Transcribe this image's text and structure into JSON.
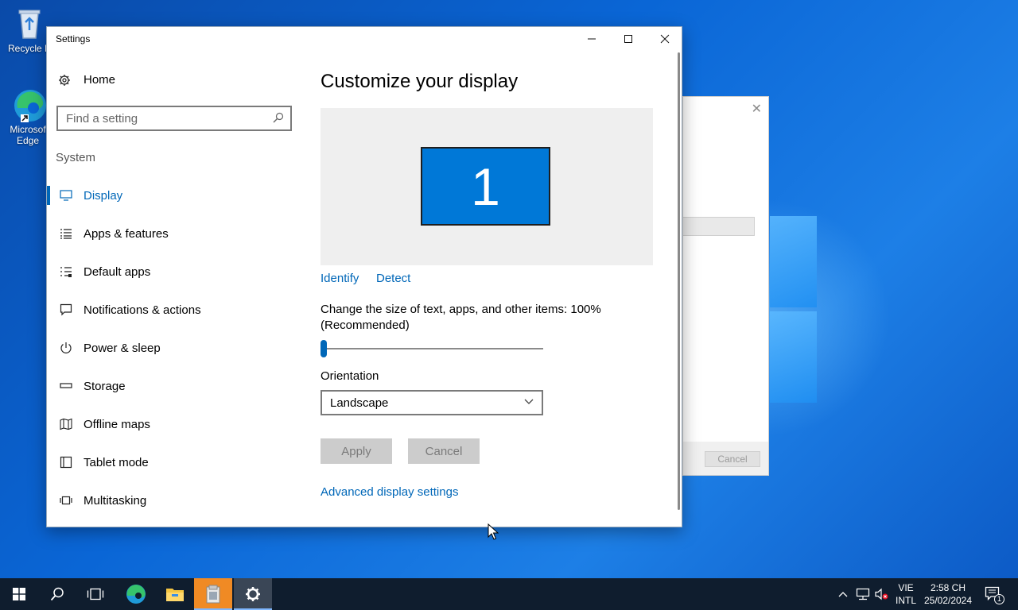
{
  "desktop": {
    "icons": [
      {
        "label": "Recycle Bin",
        "display": "Recycle B",
        "icon": "recycle-bin-icon"
      },
      {
        "label_line1": "Microsoft",
        "label_line2": "Edge",
        "display1": "Microsof",
        "icon": "edge-icon"
      }
    ]
  },
  "window": {
    "title": "Settings",
    "controls": {
      "minimize": "minimize-icon",
      "maximize": "maximize-icon",
      "close": "close-icon"
    }
  },
  "sidebar": {
    "home_label": "Home",
    "search_placeholder": "Find a setting",
    "section_label": "System",
    "items": [
      {
        "label": "Display",
        "icon": "monitor-icon",
        "active": true
      },
      {
        "label": "Apps & features",
        "icon": "list-icon"
      },
      {
        "label": "Default apps",
        "icon": "default-apps-icon"
      },
      {
        "label": "Notifications & actions",
        "icon": "notification-icon"
      },
      {
        "label": "Power & sleep",
        "icon": "power-icon"
      },
      {
        "label": "Storage",
        "icon": "storage-icon"
      },
      {
        "label": "Offline maps",
        "icon": "map-icon"
      },
      {
        "label": "Tablet mode",
        "icon": "tablet-icon"
      },
      {
        "label": "Multitasking",
        "icon": "multitasking-icon"
      }
    ]
  },
  "main": {
    "heading": "Customize your display",
    "monitor_number": "1",
    "identify_link": "Identify",
    "detect_link": "Detect",
    "scale_label_line1": "Change the size of text, apps, and other items: 100%",
    "scale_label_line2": "(Recommended)",
    "scale_slider_value": 0,
    "orientation_label": "Orientation",
    "orientation_value": "Landscape",
    "apply_label": "Apply",
    "cancel_label": "Cancel",
    "advanced_link": "Advanced display settings"
  },
  "background_dialog": {
    "cancel_label": "Cancel"
  },
  "taskbar": {
    "items": [
      "start-icon",
      "search-icon",
      "task-view-icon",
      "edge-icon",
      "file-explorer-icon",
      "installer-icon",
      "settings-icon"
    ],
    "language_line1": "VIE",
    "language_line2": "INTL",
    "time": "2:58 CH",
    "date": "25/02/2024",
    "notification_count": "1"
  },
  "colors": {
    "accent": "#0067b8",
    "monitor": "#0078d7",
    "taskbar": "#0f1d2e"
  }
}
